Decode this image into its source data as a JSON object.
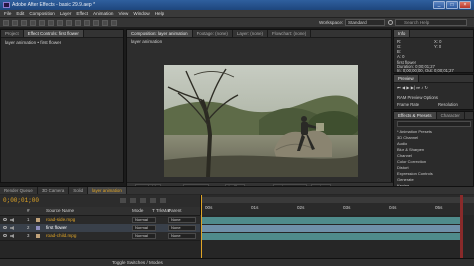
{
  "window": {
    "title": "Adobe After Effects - basic 29.9.aep *"
  },
  "menu": [
    "File",
    "Edit",
    "Composition",
    "Layer",
    "Effect",
    "Animation",
    "View",
    "Window",
    "Help"
  ],
  "toolbar": {
    "workspace_label": "Workspace:",
    "workspace_value": "Standard",
    "search_placeholder": "Search Help"
  },
  "project_panel": {
    "tabs": [
      "Project",
      "Effect Controls: first flower"
    ],
    "path": "layer animation • first flower"
  },
  "composition_panel": {
    "tabs": [
      "Composition: layer animation",
      "Footage: (none)",
      "Layer: (none)",
      "Flowchart: (none)"
    ],
    "comp_name": "layer animation",
    "bottom": {
      "zoom": "17% (1/2)",
      "timecode": "0;00;01;00",
      "resolution": "(Full)",
      "camera": "Active Camera",
      "views": "1 View"
    }
  },
  "info_panel": {
    "tab": "Info",
    "color_lines": [
      "R:",
      "G:",
      "B:",
      "A: 0"
    ],
    "coords": [
      "X: 0",
      "Y: 0"
    ],
    "layer_name": "first flower",
    "duration": "Duration: 0;00;01;27",
    "in_out": "In: 0;00;00;00, Out: 0;00;01;27"
  },
  "preview_panel": {
    "tabs": [
      "Preview"
    ],
    "ram_label": "RAM Preview Options",
    "frame_rate_label": "Frame Rate",
    "resolution_label": "Resolution"
  },
  "effects_panel": {
    "tabs": [
      "Effects & Presets",
      "Character"
    ],
    "items": [
      "* Animation Presets",
      "3D Channel",
      "Audio",
      "Blur & Sharpen",
      "Channel",
      "Color Correction",
      "Distort",
      "Expression Controls",
      "Generate",
      "Keying"
    ]
  },
  "timeline": {
    "tabs": [
      "Render Queue",
      "3D Camera",
      "Solid",
      "layer animation"
    ],
    "timecode": "0;00;01;00",
    "columns": [
      "#",
      "Source Name",
      "Mode",
      "T TrkMat",
      "Parent"
    ],
    "layers": [
      {
        "num": "1",
        "name": "road-side.mpg",
        "mode": "Normal",
        "parent": "None",
        "color": "#c0a27a",
        "name_color": "#e0a526",
        "selected": false,
        "bar_color": "#4f8b8b"
      },
      {
        "num": "2",
        "name": "first flower",
        "mode": "Normal",
        "parent": "None",
        "color": "#8f8fbf",
        "name_color": "#ffffff",
        "selected": true,
        "bar_color": "#6f90a8"
      },
      {
        "num": "3",
        "name": "road-child.mpg",
        "mode": "Normal",
        "parent": "None",
        "color": "#c0a27a",
        "name_color": "#e0a526",
        "selected": false,
        "bar_color": "#4f8b8b"
      }
    ],
    "ruler_marks": [
      "00s",
      "01s",
      "02s",
      "03s",
      "04s",
      "05s"
    ],
    "footer": "Toggle Switches / Modes",
    "playhead_percent": 0
  },
  "colors": {
    "accent_orange": "#e0a526",
    "title_blue": "#2f5f9e",
    "panel": "#2b2b2b"
  }
}
